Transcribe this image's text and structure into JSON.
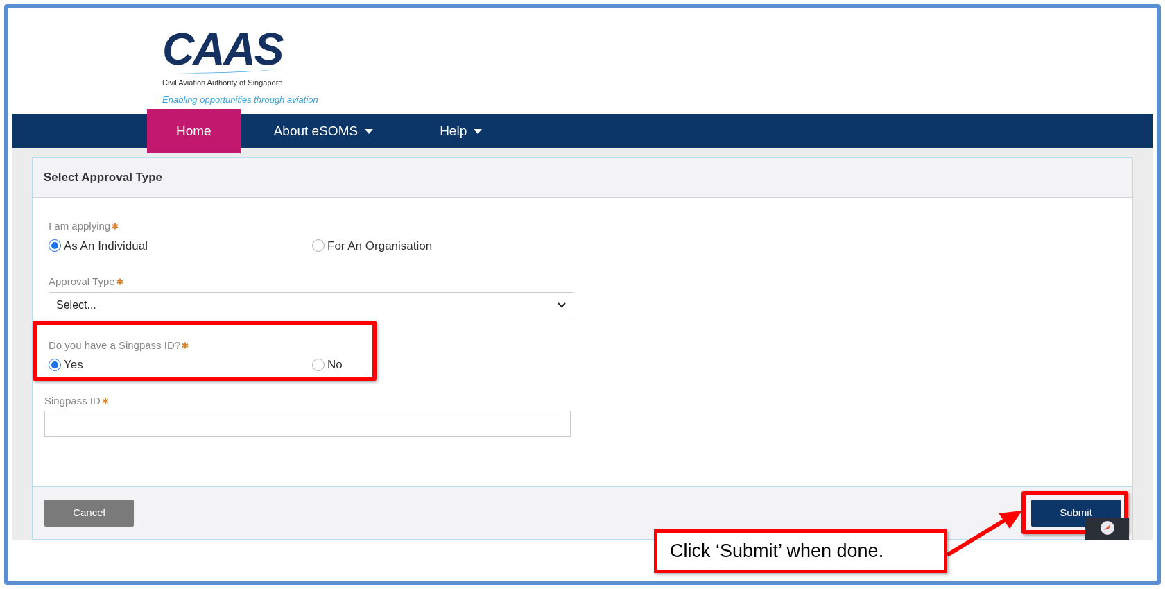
{
  "logo": {
    "wordmark": "CAAS",
    "name": "Civil Aviation Authority of Singapore",
    "slogan": "Enabling opportunities through aviation"
  },
  "nav": [
    {
      "label": "Home",
      "selected": true,
      "dropdown": false
    },
    {
      "label": "About eSOMS",
      "selected": false,
      "dropdown": true
    },
    {
      "label": "Help",
      "selected": false,
      "dropdown": true
    }
  ],
  "panel": {
    "title": "Select Approval Type",
    "fields": [
      {
        "kind": "radio",
        "label": "I am applying",
        "required": true,
        "options": [
          {
            "label": "As An Individual",
            "selected": true
          },
          {
            "label": "For An Organisation",
            "selected": false
          }
        ]
      },
      {
        "kind": "select",
        "label": "Approval Type",
        "required": true,
        "value": "Select..."
      },
      {
        "kind": "radio",
        "label": "Do you have a Singpass ID?",
        "required": true,
        "highlighted": true,
        "options": [
          {
            "label": "Yes",
            "selected": true
          },
          {
            "label": "No",
            "selected": false
          }
        ]
      },
      {
        "kind": "text",
        "label": "Singpass ID",
        "required": true
      }
    ],
    "buttons": [
      {
        "label": "Cancel",
        "kind": "secondary"
      },
      {
        "label": "Submit",
        "kind": "primary",
        "highlighted": true
      }
    ]
  },
  "callout": {
    "text": "Click ‘Submit’ when done."
  }
}
